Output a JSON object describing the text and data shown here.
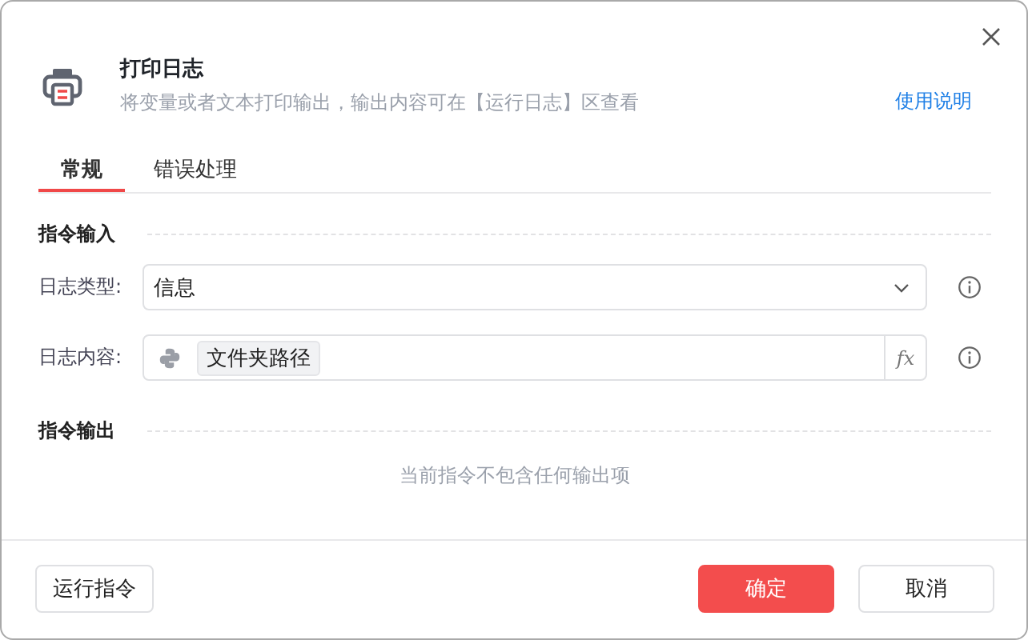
{
  "header": {
    "title": "打印日志",
    "description": "将变量或者文本打印输出，输出内容可在【运行日志】区查看",
    "help_link": "使用说明"
  },
  "tabs": [
    {
      "label": "常规",
      "selected": true
    },
    {
      "label": "错误处理",
      "selected": false
    }
  ],
  "input_section": {
    "title": "指令输入",
    "fields": [
      {
        "kind": "select",
        "label": "日志类型:",
        "value": "信息"
      },
      {
        "kind": "expression",
        "label": "日志内容:",
        "token": "文件夹路径",
        "fx": "fx"
      }
    ]
  },
  "output_section": {
    "title": "指令输出",
    "empty_text": "当前指令不包含任何输出项"
  },
  "buttons": {
    "run": "运行指令",
    "confirm": "确定",
    "cancel": "取消"
  }
}
